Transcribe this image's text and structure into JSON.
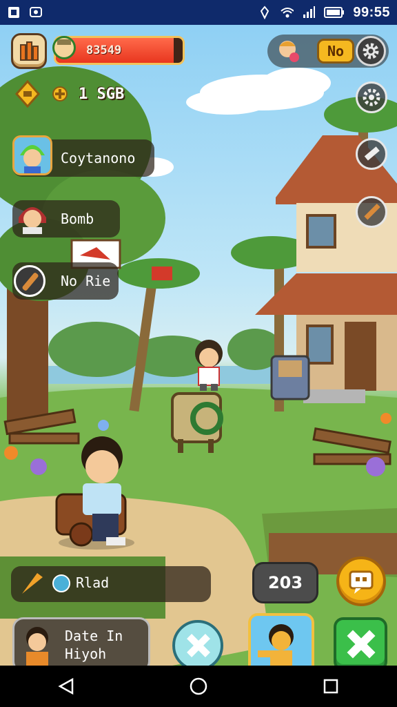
{
  "status_bar": {
    "time": "99:55",
    "left_icons": [
      "notification-icon",
      "sync-icon"
    ],
    "right_icons": [
      "location-icon",
      "wifi-icon",
      "signal-icon",
      "battery-icon"
    ]
  },
  "hud": {
    "life_value": "83549",
    "life_fill": 0.93,
    "badge_label": "No",
    "coins": "1 SGB"
  },
  "friends": [
    {
      "name": "Coytanono"
    },
    {
      "name": "Bomb"
    },
    {
      "name": "No Rie"
    }
  ],
  "quest": {
    "label": "Rlad"
  },
  "counter": {
    "value": "203"
  },
  "bottom_card": {
    "line1": "Date In",
    "line2": "Hiyoh"
  },
  "colors": {
    "sky": "#8fd0f4",
    "grass": "#6aa94a",
    "life_red": "#e8361f",
    "accent_gold": "#f5b820",
    "status_bar": "#0f2a6b"
  },
  "nav": [
    "back-icon",
    "home-icon",
    "recents-icon"
  ]
}
